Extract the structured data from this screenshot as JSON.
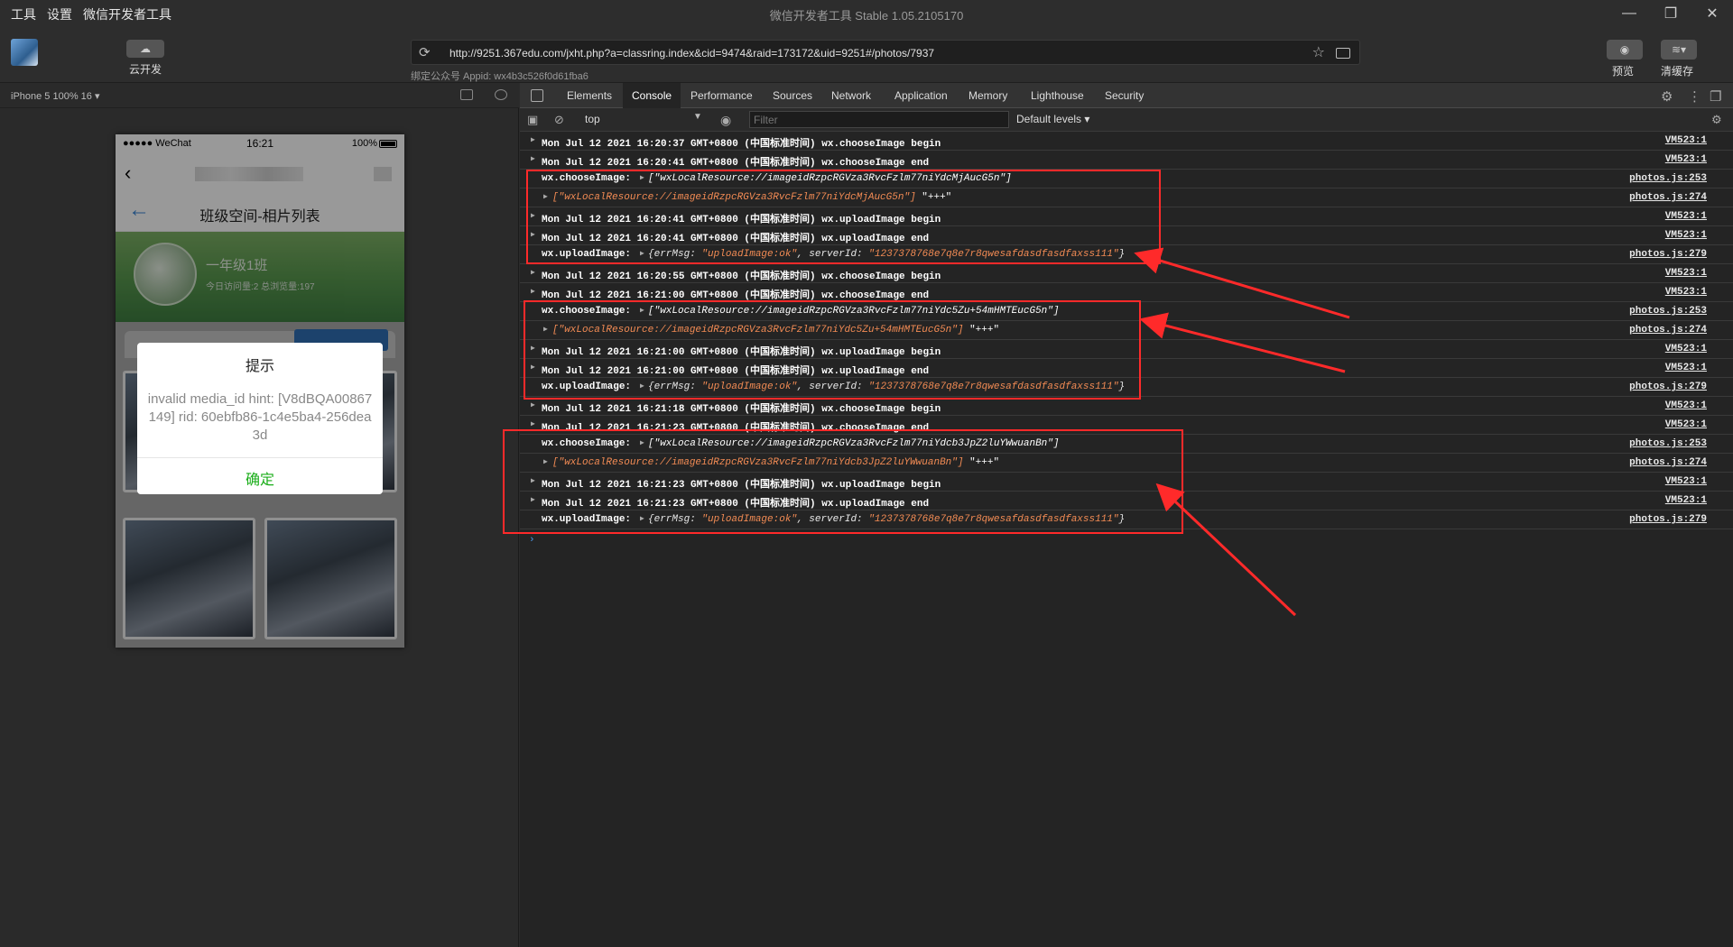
{
  "window": {
    "menu": [
      "工具",
      "设置",
      "微信开发者工具"
    ],
    "title": "微信开发者工具 Stable 1.05.2105170",
    "controls": [
      "minimize-icon",
      "maximize-icon",
      "close-icon"
    ]
  },
  "toolbar": {
    "cloud_label": "云开发",
    "url": "http://9251.367edu.com/jxht.php?a=classring.index&cid=9474&raid=173172&uid=9251#/photos/7937",
    "appid_text": "绑定公众号 Appid: wx4b3c526f0d61fba6",
    "preview_label": "预览",
    "clear_label": "清缓存"
  },
  "simulator": {
    "device": "iPhone 5 100% 16 ▾",
    "status": {
      "carrier": "●●●●● WeChat",
      "time": "16:21",
      "battery": "100%"
    },
    "page_title": "班级空间-相片列表",
    "class_name": "一年级1班",
    "class_stats": "今日访问量:2 总浏览量:197",
    "modal": {
      "title": "提示",
      "body": "invalid media_id hint: [V8dBQA00867149] rid: 60ebfb86-1c4e5ba4-256dea3d",
      "ok": "确定"
    }
  },
  "devtools": {
    "tabs": [
      "Elements",
      "Console",
      "Performance",
      "Sources",
      "Network",
      "Application",
      "Memory",
      "Lighthouse",
      "Security"
    ],
    "active_tab": "Console",
    "context": "top",
    "filter_placeholder": "Filter",
    "levels": "Default levels ▾",
    "logs": [
      {
        "type": "bold",
        "text": "Mon Jul 12 2021 16:20:37 GMT+0800 (中国标准时间) wx.chooseImage begin",
        "src": "VM523:1"
      },
      {
        "type": "bold",
        "text": "Mon Jul 12 2021 16:20:41 GMT+0800 (中国标准时间) wx.chooseImage end",
        "src": "VM523:1"
      },
      {
        "type": "choose",
        "prefix": "wx.chooseImage:",
        "value": "[\"wxLocalResource://imageidRzpcRGVza3RvcFzlm77niYdcMjAucG5n\"]",
        "src": "photos.js:253"
      },
      {
        "type": "arr",
        "value": "[\"wxLocalResource://imageidRzpcRGVza3RvcFzlm77niYdcMjAucG5n\"]",
        "suffix": "\"+++\"",
        "src": "photos.js:274"
      },
      {
        "type": "bold",
        "text": "Mon Jul 12 2021 16:20:41 GMT+0800 (中国标准时间) wx.uploadImage begin",
        "src": "VM523:1"
      },
      {
        "type": "bold",
        "text": "Mon Jul 12 2021 16:20:41 GMT+0800 (中国标准时间) wx.uploadImage end",
        "src": "VM523:1"
      },
      {
        "type": "upload",
        "prefix": "wx.uploadImage:",
        "errMsg": "\"uploadImage:ok\"",
        "serverId": "\"1237378768e7q8e7r8qwesafdasdfasdfaxss111\"",
        "src": "photos.js:279"
      },
      {
        "type": "bold",
        "text": "Mon Jul 12 2021 16:20:55 GMT+0800 (中国标准时间) wx.chooseImage begin",
        "src": "VM523:1"
      },
      {
        "type": "bold",
        "text": "Mon Jul 12 2021 16:21:00 GMT+0800 (中国标准时间) wx.chooseImage end",
        "src": "VM523:1"
      },
      {
        "type": "choose",
        "prefix": "wx.chooseImage:",
        "value": "[\"wxLocalResource://imageidRzpcRGVza3RvcFzlm77niYdc5Zu+54mHMTEucG5n\"]",
        "src": "photos.js:253"
      },
      {
        "type": "arr",
        "value": "[\"wxLocalResource://imageidRzpcRGVza3RvcFzlm77niYdc5Zu+54mHMTEucG5n\"]",
        "suffix": "\"+++\"",
        "src": "photos.js:274"
      },
      {
        "type": "bold",
        "text": "Mon Jul 12 2021 16:21:00 GMT+0800 (中国标准时间) wx.uploadImage begin",
        "src": "VM523:1"
      },
      {
        "type": "bold",
        "text": "Mon Jul 12 2021 16:21:00 GMT+0800 (中国标准时间) wx.uploadImage end",
        "src": "VM523:1"
      },
      {
        "type": "upload",
        "prefix": "wx.uploadImage:",
        "errMsg": "\"uploadImage:ok\"",
        "serverId": "\"1237378768e7q8e7r8qwesafdasdfasdfaxss111\"",
        "src": "photos.js:279"
      },
      {
        "type": "bold",
        "text": "Mon Jul 12 2021 16:21:18 GMT+0800 (中国标准时间) wx.chooseImage begin",
        "src": "VM523:1"
      },
      {
        "type": "bold",
        "text": "Mon Jul 12 2021 16:21:23 GMT+0800 (中国标准时间) wx.chooseImage end",
        "src": "VM523:1"
      },
      {
        "type": "choose",
        "prefix": "wx.chooseImage:",
        "value": "[\"wxLocalResource://imageidRzpcRGVza3RvcFzlm77niYdcb3JpZ2luYWwuanBn\"]",
        "src": "photos.js:253"
      },
      {
        "type": "arr",
        "value": "[\"wxLocalResource://imageidRzpcRGVza3RvcFzlm77niYdcb3JpZ2luYWwuanBn\"]",
        "suffix": "\"+++\"",
        "src": "photos.js:274"
      },
      {
        "type": "bold",
        "text": "Mon Jul 12 2021 16:21:23 GMT+0800 (中国标准时间) wx.uploadImage begin",
        "src": "VM523:1"
      },
      {
        "type": "bold",
        "text": "Mon Jul 12 2021 16:21:23 GMT+0800 (中国标准时间) wx.uploadImage end",
        "src": "VM523:1"
      },
      {
        "type": "upload",
        "prefix": "wx.uploadImage:",
        "errMsg": "\"uploadImage:ok\"",
        "serverId": "\"1237378768e7q8e7r8qwesafdasdfasdfaxss111\"",
        "src": "photos.js:279"
      }
    ],
    "prompt": "›"
  },
  "annotations": {
    "highlight_color": "#ff2a2a"
  }
}
